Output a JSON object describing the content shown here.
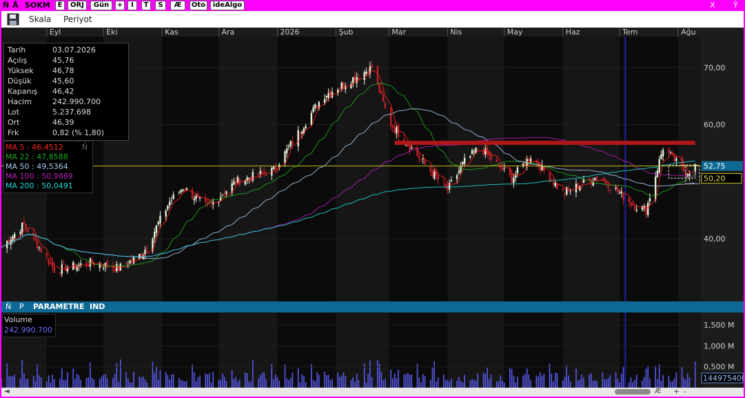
{
  "titlebar": {
    "icons": [
      "Ñ",
      "Å"
    ],
    "symbol": "SOKM",
    "buttons": [
      "Ē",
      "ORJ",
      "Gün",
      "+",
      "I",
      "T",
      "S",
      "Æ",
      "Oto",
      "ideAlgo"
    ],
    "close": "X",
    "right_glyph": "Ŷ",
    "right_dot": "•"
  },
  "menu": {
    "save_icon": "floppy-disk-icon",
    "items": [
      "Skala",
      "Periyot"
    ]
  },
  "months": [
    "Eyl",
    "Eki",
    "Kas",
    "Ara",
    "2026",
    "Şub",
    "Mar",
    "Nis",
    "May",
    "Haz",
    "Tem",
    "Ağu"
  ],
  "price_ticks": [
    "70,00",
    "60,00",
    "40,00"
  ],
  "price_tags": {
    "last": "52,75",
    "level": "50,20"
  },
  "info": [
    {
      "k": "Tarih",
      "v": "03.07.2026"
    },
    {
      "k": "Açılış",
      "v": "45,76"
    },
    {
      "k": "Yüksek",
      "v": "46,78"
    },
    {
      "k": "Düşük",
      "v": "45,60"
    },
    {
      "k": "Kapanış",
      "v": "46,42"
    },
    {
      "k": "Hacim",
      "v": "242.990.700"
    },
    {
      "k": "Lot",
      "v": "5.237.698"
    },
    {
      "k": "Ort",
      "v": "46,39"
    },
    {
      "k": "Frk",
      "v": "0,82 (% 1,80)"
    }
  ],
  "ma_legend": [
    {
      "label": "MA 5 : 46,4512",
      "color": "#ff2020"
    },
    {
      "label": "MA 22 : 47,8588",
      "color": "#22aa22"
    },
    {
      "label": "MA 50 : 49,5364",
      "color": "#aaccee"
    },
    {
      "label": "MA 100 : 50,9889",
      "color": "#bb22bb"
    },
    {
      "label": "MA 200 : 50,0491",
      "color": "#22dddd"
    }
  ],
  "ma_corner": "Ñ",
  "indicator_bar": {
    "items": [
      "Ñ",
      "P",
      "PARAMETRE",
      "IND"
    ]
  },
  "volume": {
    "title": "Volume",
    "value": "242.990.700",
    "ticks": [
      "1,500 M",
      "1,000 M",
      "0,500 M"
    ],
    "last_tag": "144975400"
  },
  "scrollbar": {
    "left_arrow": "◄",
    "right_glyphs": [
      "Æ",
      "+",
      "-"
    ]
  },
  "colors": {
    "up": "#e8f0d8",
    "down": "#c0202b",
    "resistance": "#b01818",
    "volume": "#5a5af0",
    "level_line": "#c8c020"
  },
  "chart_data": {
    "type": "candlestick",
    "title": "",
    "xlabel": "",
    "ylabel": "",
    "ylim": [
      29,
      77
    ],
    "x_range": [
      "2025-08-08",
      "2026-08-13"
    ],
    "vol_ylim": [
      0,
      1800
    ],
    "resistance": {
      "value": 56.8,
      "from": "2026-03-04",
      "to": "2026-08-10"
    },
    "level_line": 52.75,
    "anchors": [
      {
        "d": "2025-08-08",
        "c": 38.5
      },
      {
        "d": "2025-08-20",
        "c": 42.5
      },
      {
        "d": "2025-09-05",
        "c": 34.5
      },
      {
        "d": "2025-09-25",
        "c": 35.8
      },
      {
        "d": "2025-10-09",
        "c": 34.8
      },
      {
        "d": "2025-10-22",
        "c": 37.5
      },
      {
        "d": "2025-11-05",
        "c": 46.5
      },
      {
        "d": "2025-11-12",
        "c": 49.0
      },
      {
        "d": "2025-11-25",
        "c": 45.5
      },
      {
        "d": "2025-12-10",
        "c": 50.0
      },
      {
        "d": "2025-12-30",
        "c": 52.0
      },
      {
        "d": "2026-01-25",
        "c": 65.0
      },
      {
        "d": "2026-02-20",
        "c": 70.0
      },
      {
        "d": "2026-03-01",
        "c": 60.5
      },
      {
        "d": "2026-03-20",
        "c": 53.0
      },
      {
        "d": "2026-04-01",
        "c": 48.5
      },
      {
        "d": "2026-04-10",
        "c": 53.5
      },
      {
        "d": "2026-04-18",
        "c": 56.0
      },
      {
        "d": "2026-05-05",
        "c": 50.5
      },
      {
        "d": "2026-05-15",
        "c": 54.5
      },
      {
        "d": "2026-06-01",
        "c": 48.0
      },
      {
        "d": "2026-06-20",
        "c": 51.0
      },
      {
        "d": "2026-07-08",
        "c": 46.0
      },
      {
        "d": "2026-07-15",
        "c": 45.0
      },
      {
        "d": "2026-07-24",
        "c": 56.0
      },
      {
        "d": "2026-08-05",
        "c": 51.5
      },
      {
        "d": "2026-08-10",
        "c": 52.7
      }
    ],
    "ma_values": {
      "MA 5": 46.4512,
      "MA 22": 47.8588,
      "MA 50": 49.5364,
      "MA 100": 50.9889,
      "MA 200": 50.0491
    }
  }
}
